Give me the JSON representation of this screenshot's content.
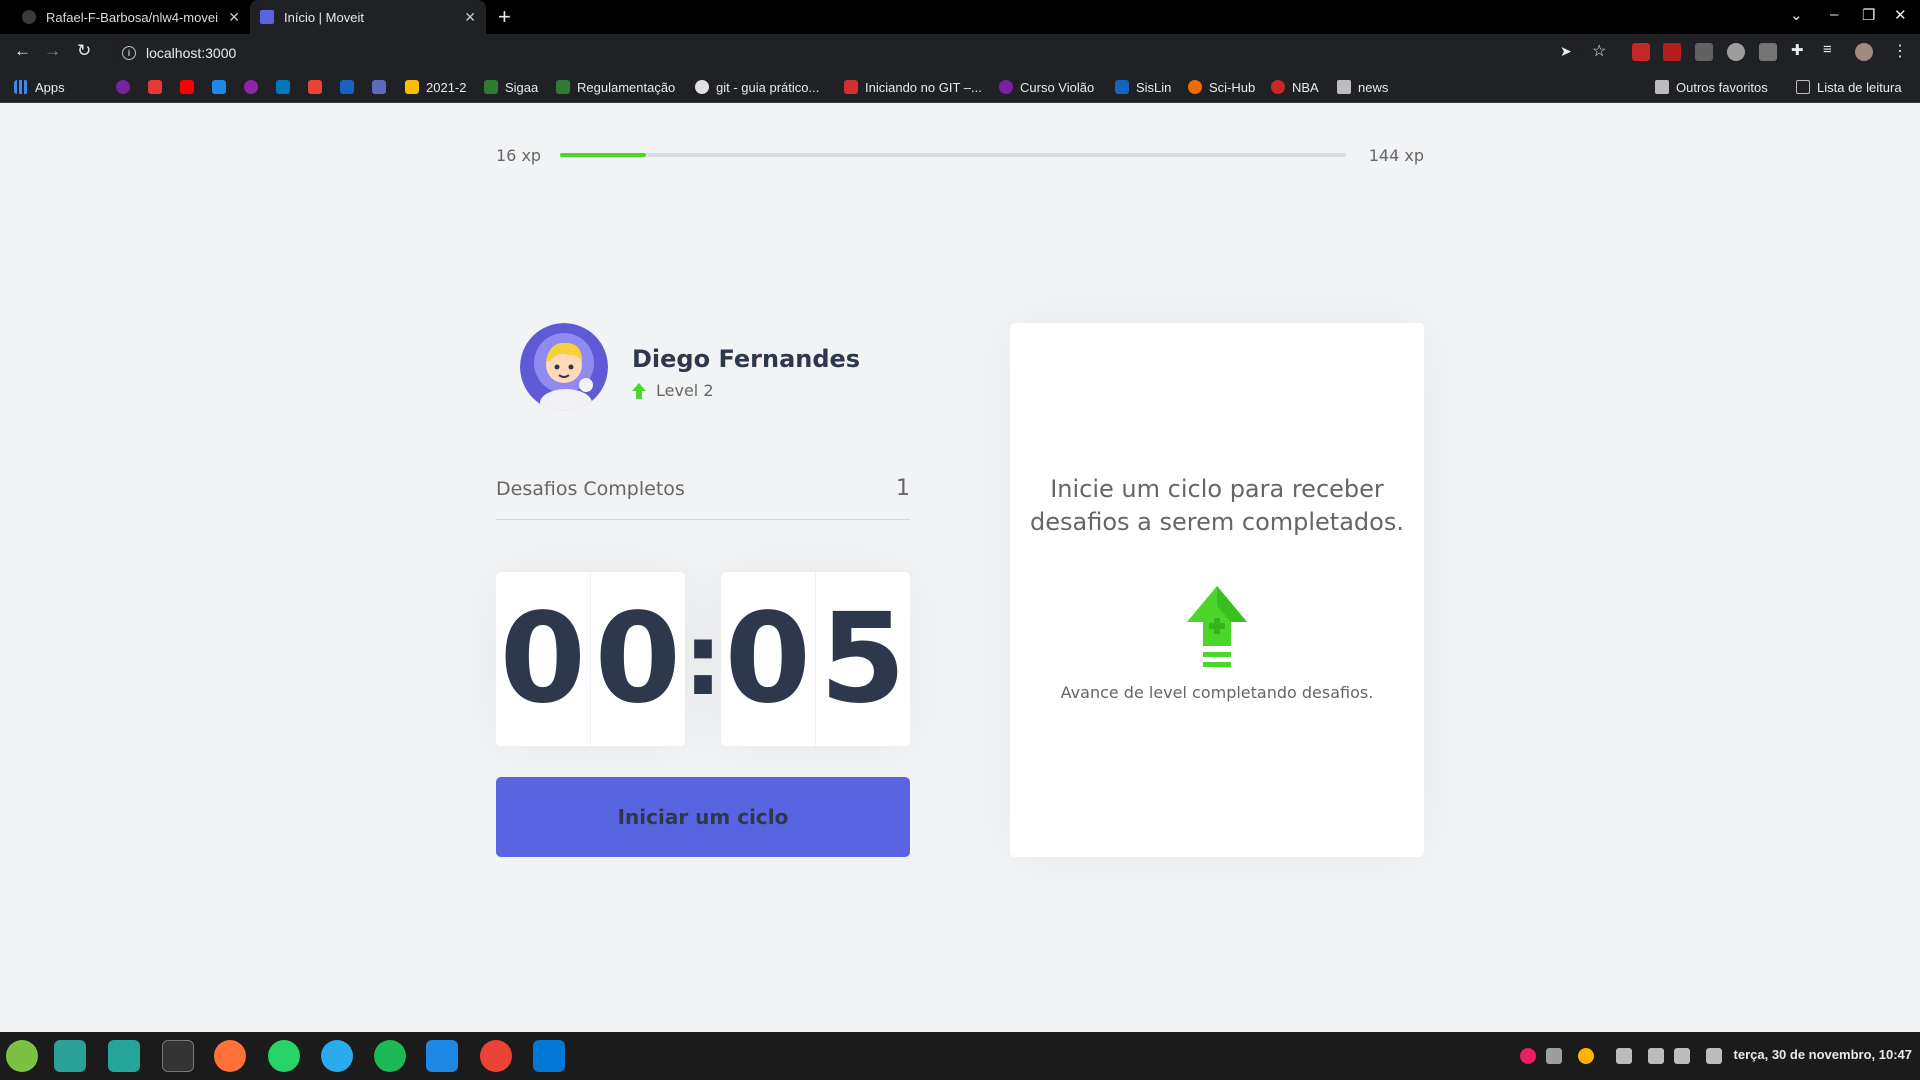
{
  "browser": {
    "tabs": [
      {
        "title": "Rafael-F-Barbosa/nlw4-movei",
        "active": false
      },
      {
        "title": "Início | Moveit",
        "active": true
      }
    ],
    "url": "localhost:3000",
    "bookmarks": {
      "apps": "Apps",
      "items": [
        "2021-2",
        "Sigaa",
        "Regulamentação",
        "git - guia prático...",
        "Iniciando no GIT –...",
        "Curso Violão",
        "SisLin",
        "Sci-Hub",
        "NBA",
        "news"
      ],
      "other": "Outros favoritos",
      "reading_list": "Lista de leitura"
    }
  },
  "app": {
    "xp": {
      "current_label": "16 xp",
      "next_label": "144 xp",
      "progress_percent": 11
    },
    "profile": {
      "name": "Diego Fernandes",
      "level": "Level 2"
    },
    "completed": {
      "label": "Desafios Completos",
      "count": "1"
    },
    "countdown": {
      "minutes": [
        "0",
        "0"
      ],
      "colon": ":",
      "seconds": [
        "0",
        "5"
      ]
    },
    "start_button": "Iniciar um ciclo",
    "challenge": {
      "title": "Inicie um ciclo para receber desafios a serem completados.",
      "hint": "Avance de level completando desafios."
    },
    "colors": {
      "accent": "#5965e0",
      "green": "#4cd62b",
      "text": "#666666",
      "title": "#2e384d"
    }
  },
  "taskbar": {
    "clock": "terça, 30 de novembro, 10:47"
  }
}
